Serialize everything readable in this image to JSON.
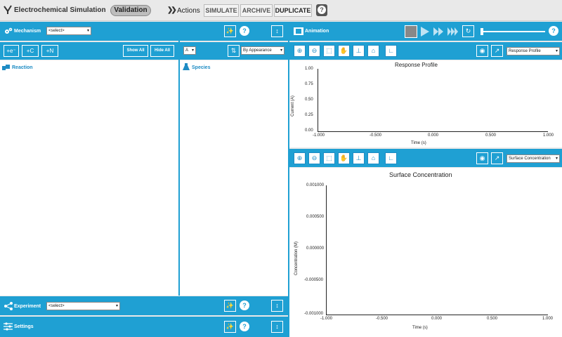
{
  "app": {
    "title": "Electrochemical Simulation",
    "mode": "Validation",
    "actions_label": "Actions"
  },
  "actions": [
    "SIMULATE",
    "ARCHIVE",
    "DUPLICATE"
  ],
  "mechanism": {
    "label": "Mechanism",
    "select_value": "<select>"
  },
  "toolbar_left": {
    "add_e": "+e⁻",
    "add_c": "+C",
    "add_n": "+N",
    "show_all": "Show All",
    "hide_all": "Hide All"
  },
  "species_toolbar": {
    "sort_select": "By Appearance",
    "letter_select": "A"
  },
  "reaction_label": "Reaction",
  "species_label": "Species",
  "experiment": {
    "label": "Experiment",
    "select_value": "<select>"
  },
  "settings": {
    "label": "Settings"
  },
  "animation": {
    "label": "Animation"
  },
  "plot1": {
    "select": "Response Profile",
    "title": "Response Profile",
    "xlabel": "Time (s)",
    "ylabel": "Current (A)",
    "xticks": [
      "-1.000",
      "-0.500",
      "0.000",
      "0.500",
      "1.000"
    ],
    "yticks": [
      "1.00",
      "0.75",
      "0.50",
      "0.25",
      "0.00"
    ]
  },
  "plot2": {
    "select": "Surface Concentration",
    "title": "Surface Concentration",
    "xlabel": "Time (s)",
    "ylabel": "Concentration (M)",
    "xticks": [
      "-1.000",
      "-0.500",
      "0.000",
      "0.500",
      "1.000"
    ],
    "yticks": [
      "0.001000",
      "0.000500",
      "0.000000",
      "-0.000500",
      "-0.001000"
    ]
  },
  "chart_data": [
    {
      "type": "line",
      "title": "Response Profile",
      "xlabel": "Time (s)",
      "ylabel": "Current (A)",
      "xlim": [
        -1,
        1
      ],
      "ylim": [
        0,
        1
      ],
      "series": []
    },
    {
      "type": "line",
      "title": "Surface Concentration",
      "xlabel": "Time (s)",
      "ylabel": "Concentration (M)",
      "xlim": [
        -1,
        1
      ],
      "ylim": [
        -0.001,
        0.001
      ],
      "series": []
    }
  ],
  "colors": {
    "accent": "#1fa0d3",
    "background": "#e9e9e9"
  }
}
